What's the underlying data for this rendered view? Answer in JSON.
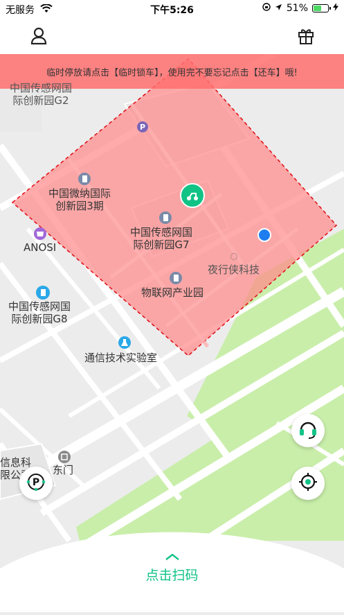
{
  "status_bar": {
    "carrier": "无服务",
    "time": "下午5:26",
    "battery_percent": "51%",
    "battery_level": 0.51
  },
  "top_nav": {
    "left_icon": "user-icon",
    "right_icon": "gift-icon"
  },
  "banner": {
    "text": "临时停放请点击【临时锁车】，使用完不要忘记点击【还车】哦!"
  },
  "map": {
    "labels": {
      "g2": "中国传感网国\n际创新园G2",
      "nano": "中国微纳国际\n创新园3期",
      "g7": "中国传感网国\n际创新园G7",
      "anosi": "ANOSI",
      "yexingxia": "夜行侠科技",
      "g8": "中国传感网国\n际创新园G8",
      "iot": "物联网产业园",
      "lab": "通信技术实验室",
      "info": "信息科\n限公司",
      "east_gate": "东门"
    },
    "zone_color": "#ff8a8a",
    "green_color": "#c9eeaa",
    "accent": "#12c386"
  },
  "buttons": {
    "support_icon": "headset-icon",
    "locate_icon": "locate-icon",
    "parking_icon": "parking-icon"
  },
  "bottom": {
    "scan_label": "点击扫码"
  }
}
